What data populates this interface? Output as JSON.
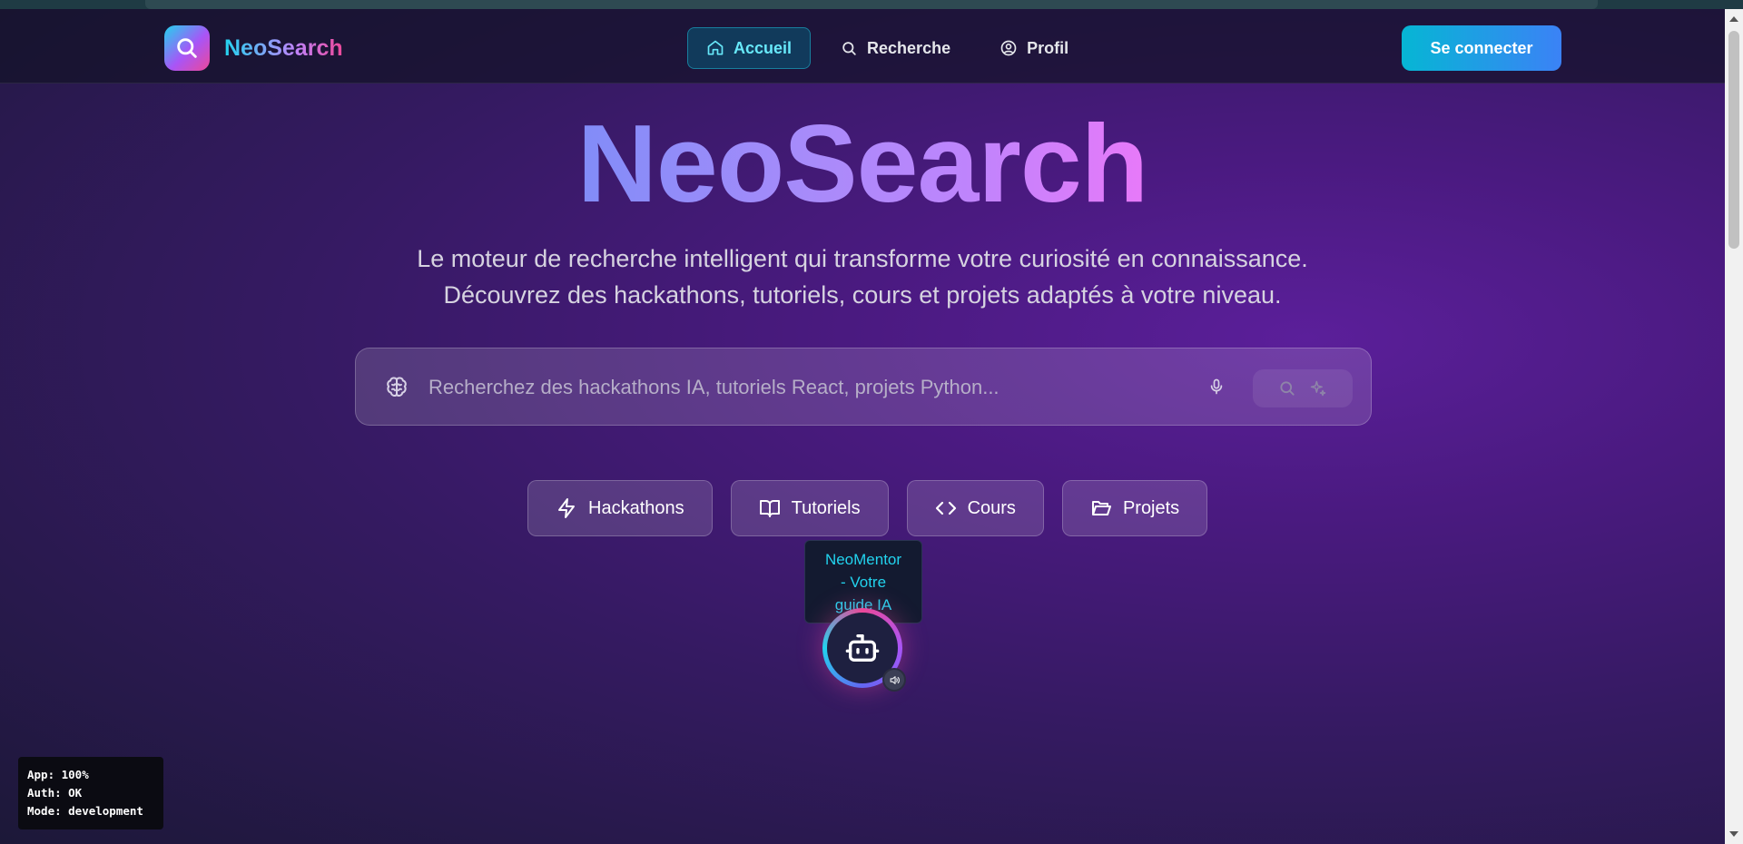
{
  "brand": {
    "name": "NeoSearch",
    "logo_icon": "search-icon"
  },
  "nav": {
    "items": [
      {
        "label": "Accueil",
        "icon": "home-icon",
        "active": true
      },
      {
        "label": "Recherche",
        "icon": "search-icon",
        "active": false
      },
      {
        "label": "Profil",
        "icon": "user-circle-icon",
        "active": false
      }
    ]
  },
  "login_label": "Se connecter",
  "hero": {
    "title": "NeoSearch",
    "subtitle_line1": "Le moteur de recherche intelligent qui transforme votre curiosité en connaissance.",
    "subtitle_line2": "Découvrez des hackathons, tutoriels, cours et projets adaptés à votre niveau."
  },
  "search": {
    "placeholder": "Recherchez des hackathons IA, tutoriels React, projets Python...",
    "value": "",
    "left_icon": "brain-icon",
    "mic_icon": "mic-icon",
    "submit_icons": [
      "search-icon",
      "sparkles-icon"
    ]
  },
  "categories": [
    {
      "label": "Hackathons",
      "icon": "zap-icon"
    },
    {
      "label": "Tutoriels",
      "icon": "book-open-icon"
    },
    {
      "label": "Cours",
      "icon": "code-icon"
    },
    {
      "label": "Projets",
      "icon": "folder-open-icon"
    }
  ],
  "assistant": {
    "tooltip_line1": "NeoMentor",
    "tooltip_line2": "- Votre",
    "tooltip_line3": "guide IA",
    "icon": "bot-icon",
    "badge_icon": "volume-icon"
  },
  "debug": {
    "line1": "App: 100%",
    "line2": "Auth: OK",
    "line3": "Mode: development"
  },
  "colors": {
    "accent_cyan": "#22d3ee",
    "accent_purple": "#a855f7",
    "accent_pink": "#ec4899",
    "login_from": "#06b6d4",
    "login_to": "#3b82f6"
  }
}
